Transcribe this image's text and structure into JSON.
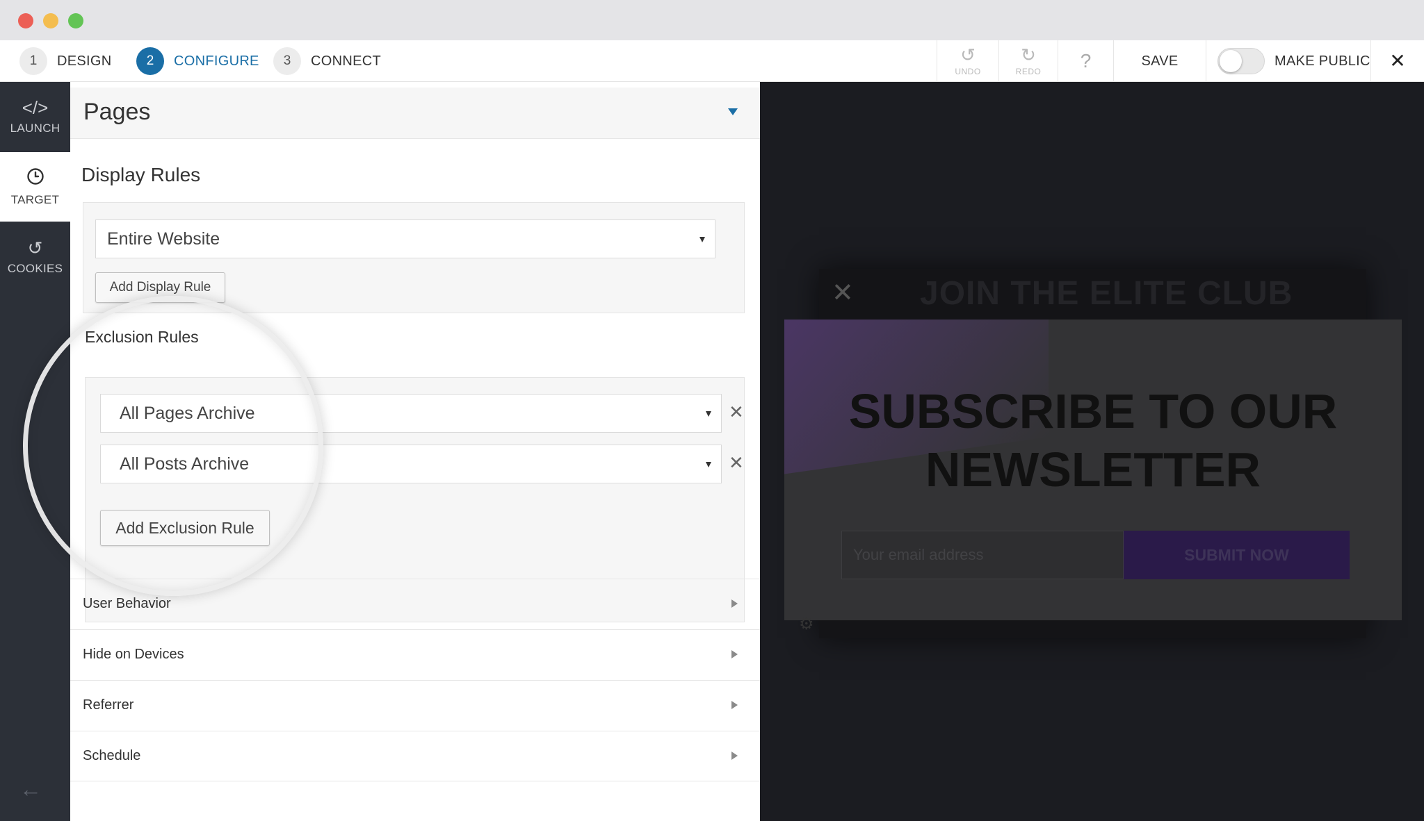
{
  "steps": [
    {
      "num": "1",
      "label": "DESIGN"
    },
    {
      "num": "2",
      "label": "CONFIGURE"
    },
    {
      "num": "3",
      "label": "CONNECT"
    }
  ],
  "toolbar": {
    "undo_label": "UNDO",
    "redo_label": "REDO",
    "help_label": "?",
    "save_label": "SAVE",
    "make_public_label": "MAKE PUBLIC",
    "make_public_on": false
  },
  "sidebar": {
    "items": [
      {
        "label": "LAUNCH",
        "icon": "code-icon"
      },
      {
        "label": "TARGET",
        "icon": "clock-icon"
      },
      {
        "label": "COOKIES",
        "icon": "refresh-icon"
      }
    ]
  },
  "panel": {
    "pages_title": "Pages",
    "display_rules_title": "Display Rules",
    "display_rule_value": "Entire Website",
    "add_display_rule": "Add Display Rule",
    "exclusion_rules_title": "Exclusion Rules",
    "exclusions": [
      "All Pages Archive",
      "All Posts Archive"
    ],
    "add_exclusion_rule": "Add Exclusion Rule",
    "sections": [
      "User Behavior",
      "Hide on Devices",
      "Referrer",
      "Schedule"
    ]
  },
  "preview": {
    "back_title": "JOIN THE ELITE CLUB",
    "headline_line1": "SUBSCRIBE TO OUR",
    "headline_line2": "NEWSLETTER",
    "email_placeholder": "Your email address",
    "submit_label": "SUBMIT NOW"
  },
  "colors": {
    "accent": "#1a6ea6",
    "sidebar_bg": "#2c3038",
    "preview_bg": "#1b1c21",
    "submit_bg": "#2a1a49"
  }
}
